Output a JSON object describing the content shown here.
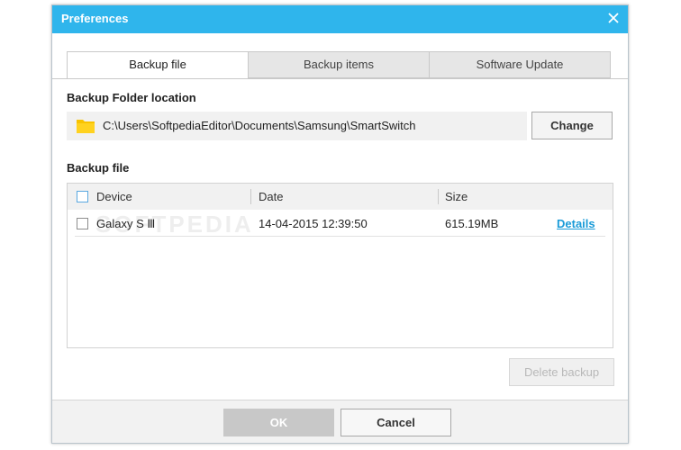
{
  "dialog": {
    "title": "Preferences",
    "close_icon": "close-icon"
  },
  "tabs": [
    {
      "label": "Backup file",
      "active": true
    },
    {
      "label": "Backup items",
      "active": false
    },
    {
      "label": "Software Update",
      "active": false
    }
  ],
  "backup_folder": {
    "heading": "Backup Folder location",
    "path": "C:\\Users\\SoftpediaEditor\\Documents\\Samsung\\SmartSwitch",
    "folder_icon": "folder-icon",
    "change_label": "Change"
  },
  "backup_file": {
    "heading": "Backup file",
    "columns": [
      "Device",
      "Date",
      "Size"
    ],
    "rows": [
      {
        "device": "Galaxy S Ⅲ",
        "date": "14-04-2015 12:39:50",
        "size": "615.19MB",
        "details": "Details"
      }
    ],
    "delete_label": "Delete backup"
  },
  "watermark": "SOFTPEDIA",
  "footer": {
    "ok_label": "OK",
    "cancel_label": "Cancel"
  },
  "colors": {
    "titlebar": "#2fb5ec",
    "link": "#1a9bd8",
    "folder": "#f8c300"
  }
}
